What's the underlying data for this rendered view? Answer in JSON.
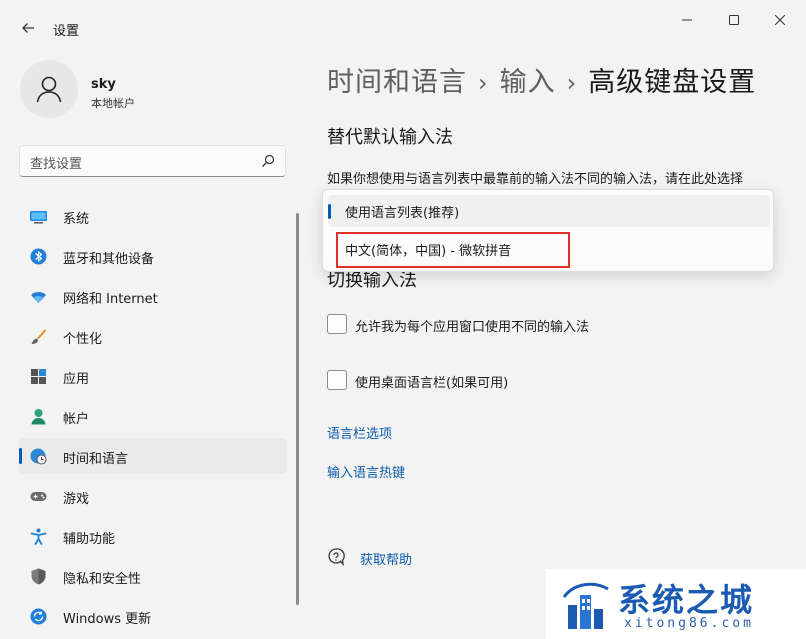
{
  "app": {
    "title": "设置"
  },
  "user": {
    "name": "sky",
    "account_type": "本地帐户"
  },
  "search": {
    "placeholder": "查找设置"
  },
  "sidebar": {
    "items": [
      {
        "label": "系统",
        "icon": "monitor-icon"
      },
      {
        "label": "蓝牙和其他设备",
        "icon": "bluetooth-icon"
      },
      {
        "label": "网络和 Internet",
        "icon": "wifi-icon"
      },
      {
        "label": "个性化",
        "icon": "brush-icon"
      },
      {
        "label": "应用",
        "icon": "apps-icon"
      },
      {
        "label": "帐户",
        "icon": "person-icon"
      },
      {
        "label": "时间和语言",
        "icon": "globe-clock-icon",
        "active": true
      },
      {
        "label": "游戏",
        "icon": "gamepad-icon"
      },
      {
        "label": "辅助功能",
        "icon": "accessibility-icon"
      },
      {
        "label": "隐私和安全性",
        "icon": "shield-icon"
      },
      {
        "label": "Windows 更新",
        "icon": "update-icon"
      }
    ]
  },
  "breadcrumb": {
    "level1": "时间和语言",
    "level2": "输入",
    "current": "高级键盘设置",
    "separator": "›"
  },
  "main": {
    "override_title": "替代默认输入法",
    "override_desc": "如果你想使用与语言列表中最靠前的输入法不同的输入法，请在此处选择",
    "dropdown_options": [
      "使用语言列表(推荐)",
      "中文(简体，中国) - 微软拼音"
    ],
    "switch_title": "切换输入法",
    "checkbox1": "允许我为每个应用窗口使用不同的输入法",
    "checkbox2": "使用桌面语言栏(如果可用)",
    "link1": "语言栏选项",
    "link2": "输入语言热键",
    "help": "获取帮助"
  },
  "watermark": {
    "title": "系统之城",
    "subtitle": "xitong86.com"
  },
  "colors": {
    "accent": "#005fb8",
    "link": "#0b5cad",
    "highlight": "#e0302a",
    "brand": "#1c5bb3"
  }
}
